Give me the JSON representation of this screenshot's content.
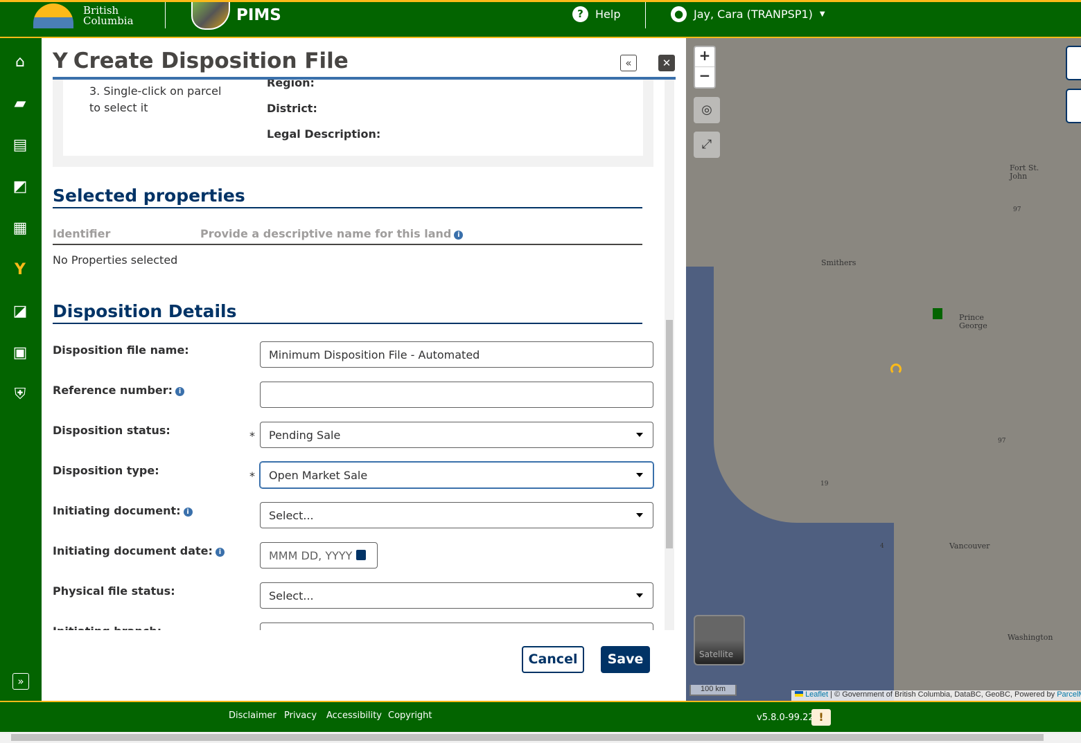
{
  "header": {
    "logo_text": [
      "British",
      "Columbia"
    ],
    "app_name": "PIMS",
    "help_label": "Help",
    "user_label": "Jay, Cara (TRANPSP1)"
  },
  "panel": {
    "title": "Create Disposition File",
    "instructions": {
      "step3": "3. Single-click on parcel to select it"
    },
    "parcel_info": {
      "region_label": "Region:",
      "district_label": "District:",
      "legal_label": "Legal Description:"
    },
    "selected_properties": {
      "heading": "Selected properties",
      "col_identifier": "Identifier",
      "col_name": "Provide a descriptive name for this land",
      "empty_text": "No Properties selected"
    },
    "details": {
      "heading": "Disposition Details",
      "file_name_label": "Disposition file name:",
      "file_name_value": "Minimum Disposition File - Automated",
      "reference_label": "Reference number:",
      "reference_value": "",
      "status_label": "Disposition status:",
      "status_value": "Pending Sale",
      "type_label": "Disposition type:",
      "type_value": "Open Market Sale",
      "initiating_doc_label": "Initiating document:",
      "initiating_doc_value": "Select...",
      "initiating_date_label": "Initiating document date:",
      "initiating_date_placeholder": "MMM DD, YYYY",
      "physical_status_label": "Physical file status:",
      "physical_status_value": "Select...",
      "initiating_branch_label": "Initiating branch:",
      "required_mark": "*"
    },
    "cancel_label": "Cancel",
    "save_label": "Save"
  },
  "map": {
    "zoom_in": "+",
    "zoom_out": "−",
    "satellite_label": "Satellite",
    "scale": "100 km",
    "attribution_link": "Leaflet",
    "attribution_text": " | © Government of British Columbia, DataBC, GeoBC, Powered by ",
    "attribution_link2": "ParcelMap",
    "labels": {
      "fort_st_john": "Fort St. John",
      "smithers": "Smithers",
      "prince_george": "Prince George",
      "vancouver": "Vancouver",
      "washington": "Washington",
      "hw97a": "97",
      "hw97b": "97",
      "hw19": "19",
      "hw4": "4"
    }
  },
  "footer": {
    "links": [
      "Disclaimer",
      "Privacy",
      "Accessibility",
      "Copyright"
    ],
    "version": "v5.8.0-99.22"
  },
  "colors": {
    "primary": "#036400",
    "accent": "#fcba19",
    "navy": "#013366"
  }
}
